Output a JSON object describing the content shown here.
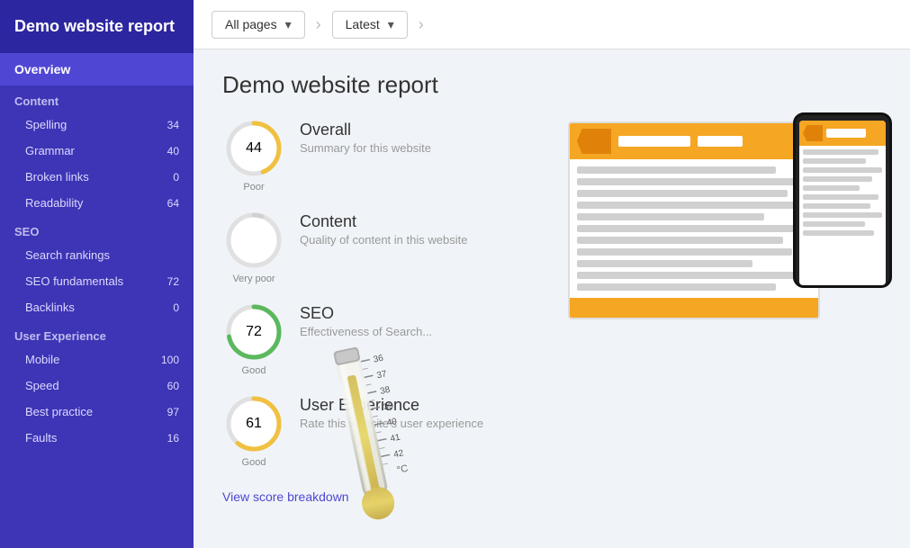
{
  "sidebar": {
    "title": "Demo website report",
    "nav": {
      "overview_label": "Overview",
      "sections": [
        {
          "label": "Content",
          "items": [
            {
              "label": "Spelling",
              "badge": "34"
            },
            {
              "label": "Grammar",
              "badge": "40"
            },
            {
              "label": "Broken links",
              "badge": "0"
            },
            {
              "label": "Readability",
              "badge": "64"
            }
          ]
        },
        {
          "label": "SEO",
          "items": [
            {
              "label": "Search rankings",
              "badge": ""
            },
            {
              "label": "SEO fundamentals",
              "badge": "72"
            },
            {
              "label": "Backlinks",
              "badge": "0"
            }
          ]
        },
        {
          "label": "User Experience",
          "items": [
            {
              "label": "Mobile",
              "badge": "100"
            },
            {
              "label": "Speed",
              "badge": "60"
            },
            {
              "label": "Best practice",
              "badge": "97"
            },
            {
              "label": "Faults",
              "badge": "16"
            }
          ]
        }
      ]
    }
  },
  "topbar": {
    "filter1_label": "All pages",
    "filter2_label": "Latest"
  },
  "main": {
    "page_title": "Demo website report",
    "scores": [
      {
        "value": 44,
        "label": "Overall",
        "sublabel": "Summary for this website",
        "quality": "Poor",
        "color": "#f0c040",
        "ring_color": "#f0c040"
      },
      {
        "value": null,
        "label": "Content",
        "sublabel": "Quality of content in this website",
        "quality": "Very poor",
        "color": "#d0d0d0",
        "ring_color": "#d0d0d0"
      },
      {
        "value": 72,
        "label": "SEO",
        "sublabel": "Effectiveness of Search...",
        "quality": "Good",
        "color": "#5cb85c",
        "ring_color": "#5cb85c"
      },
      {
        "value": 61,
        "label": "User Experience",
        "sublabel": "Rate this website's user experience",
        "quality": "Good",
        "color": "#f0c040",
        "ring_color": "#f0c040"
      }
    ],
    "view_link": "View score breakdown"
  }
}
